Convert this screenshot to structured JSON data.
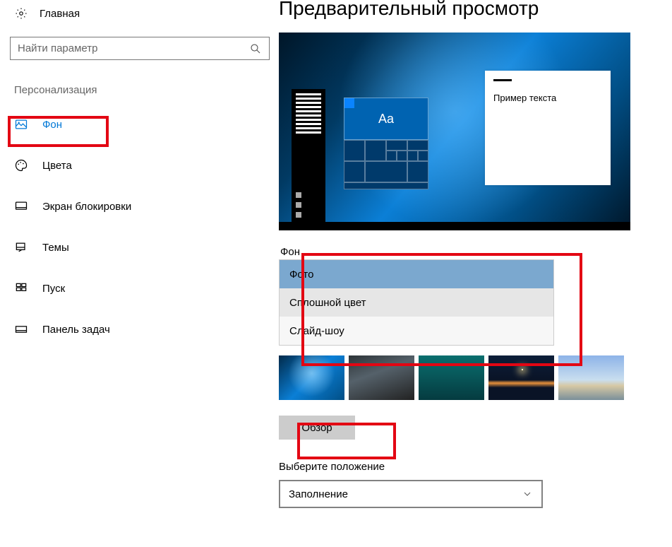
{
  "home_label": "Главная",
  "search": {
    "placeholder": "Найти параметр"
  },
  "section_title": "Персонализация",
  "nav": {
    "items": [
      {
        "label": "Фон"
      },
      {
        "label": "Цвета"
      },
      {
        "label": "Экран блокировки"
      },
      {
        "label": "Темы"
      },
      {
        "label": "Пуск"
      },
      {
        "label": "Панель задач"
      }
    ]
  },
  "preview": {
    "title": "Предварительный просмотр",
    "sample_text": "Пример текста",
    "tile_text": "Aa"
  },
  "background_section": {
    "label": "Фон",
    "options": [
      {
        "label": "Фото"
      },
      {
        "label": "Сплошной цвет"
      },
      {
        "label": "Слайд-шоу"
      }
    ]
  },
  "browse_label": "Обзор",
  "fit": {
    "label": "Выберите положение",
    "value": "Заполнение"
  }
}
